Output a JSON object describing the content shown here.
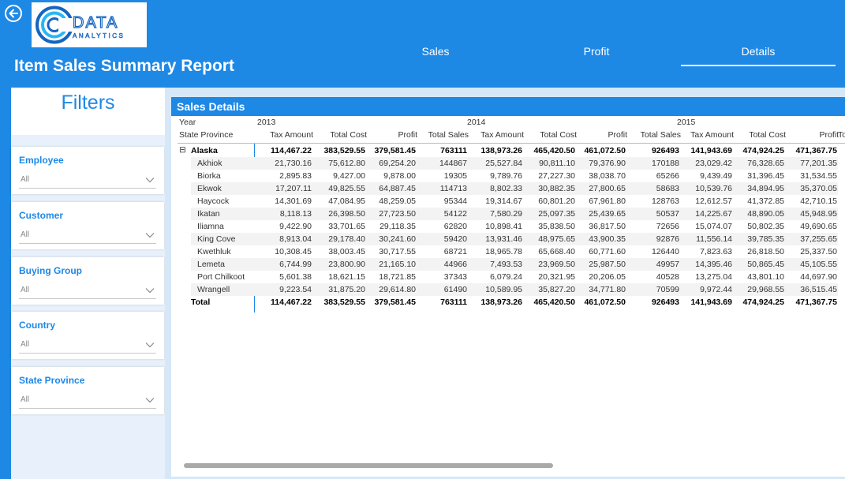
{
  "header": {
    "title": "Item Sales Summary Report",
    "logo_text": "DATA",
    "logo_subtext": "ANALYTICS",
    "tabs": [
      {
        "label": "Sales"
      },
      {
        "label": "Profit"
      },
      {
        "label": "Details"
      }
    ]
  },
  "filters": {
    "title": "Filters",
    "slicers": [
      {
        "label": "Employee",
        "value": "All"
      },
      {
        "label": "Customer",
        "value": "All"
      },
      {
        "label": "Buying Group",
        "value": "All"
      },
      {
        "label": "Country",
        "value": "All"
      },
      {
        "label": "State Province",
        "value": "All"
      }
    ]
  },
  "details": {
    "title": "Sales Details",
    "year_header": "Year",
    "row_header": "State Province",
    "years": [
      "2013",
      "2014",
      "2015"
    ],
    "measures": [
      "Tax Amount",
      "Total Cost",
      "Profit",
      "Total Sales"
    ],
    "truncated_header": "To",
    "group": {
      "expand_icon": "⊟",
      "label": "Alaska",
      "values": [
        "114,467.22",
        "383,529.55",
        "379,581.45",
        "763111",
        "138,973.26",
        "465,420.50",
        "461,072.50",
        "926493",
        "141,943.69",
        "474,924.25",
        "471,367.75"
      ]
    },
    "rows": [
      {
        "label": "Akhiok",
        "values": [
          "21,730.16",
          "75,612.80",
          "69,254.20",
          "144867",
          "25,527.84",
          "90,811.10",
          "79,376.90",
          "170188",
          "23,029.42",
          "76,328.65",
          "77,201.35"
        ]
      },
      {
        "label": "Biorka",
        "values": [
          "2,895.83",
          "9,427.00",
          "9,878.00",
          "19305",
          "9,789.76",
          "27,227.30",
          "38,038.70",
          "65266",
          "9,439.49",
          "31,396.45",
          "31,534.55"
        ]
      },
      {
        "label": "Ekwok",
        "values": [
          "17,207.11",
          "49,825.55",
          "64,887.45",
          "114713",
          "8,802.33",
          "30,882.35",
          "27,800.65",
          "58683",
          "10,539.76",
          "34,894.95",
          "35,370.05"
        ]
      },
      {
        "label": "Haycock",
        "values": [
          "14,301.69",
          "47,084.95",
          "48,259.05",
          "95344",
          "19,314.67",
          "60,801.20",
          "67,961.80",
          "128763",
          "12,612.57",
          "41,372.85",
          "42,710.15"
        ]
      },
      {
        "label": "Ikatan",
        "values": [
          "8,118.13",
          "26,398.50",
          "27,723.50",
          "54122",
          "7,580.29",
          "25,097.35",
          "25,439.65",
          "50537",
          "14,225.67",
          "48,890.05",
          "45,948.95"
        ]
      },
      {
        "label": "Iliamna",
        "values": [
          "9,422.90",
          "33,701.65",
          "29,118.35",
          "62820",
          "10,898.41",
          "35,838.50",
          "36,817.50",
          "72656",
          "15,074.07",
          "50,802.35",
          "49,690.65"
        ]
      },
      {
        "label": "King Cove",
        "values": [
          "8,913.04",
          "29,178.40",
          "30,241.60",
          "59420",
          "13,931.46",
          "48,975.65",
          "43,900.35",
          "92876",
          "11,556.14",
          "39,785.35",
          "37,255.65"
        ]
      },
      {
        "label": "Kwethluk",
        "values": [
          "10,308.45",
          "38,003.45",
          "30,717.55",
          "68721",
          "18,965.78",
          "65,668.40",
          "60,771.60",
          "126440",
          "7,823.63",
          "26,818.50",
          "25,337.50"
        ]
      },
      {
        "label": "Lemeta",
        "values": [
          "6,744.99",
          "23,800.90",
          "21,165.10",
          "44966",
          "7,493.53",
          "23,969.50",
          "25,987.50",
          "49957",
          "14,395.46",
          "50,865.45",
          "45,105.55"
        ]
      },
      {
        "label": "Port Chilkoot",
        "values": [
          "5,601.38",
          "18,621.15",
          "18,721.85",
          "37343",
          "6,079.24",
          "20,321.95",
          "20,206.05",
          "40528",
          "13,275.04",
          "43,801.10",
          "44,697.90"
        ]
      },
      {
        "label": "Wrangell",
        "values": [
          "9,223.54",
          "31,875.20",
          "29,614.80",
          "61490",
          "10,589.95",
          "35,827.20",
          "34,771.80",
          "70599",
          "9,972.44",
          "29,968.55",
          "36,515.45"
        ]
      }
    ],
    "total": {
      "label": "Total",
      "values": [
        "114,467.22",
        "383,529.55",
        "379,581.45",
        "763111",
        "138,973.26",
        "465,420.50",
        "461,072.50",
        "926493",
        "141,943.69",
        "474,924.25",
        "471,367.75"
      ]
    }
  },
  "colors": {
    "brand_blue": "#1E88E5",
    "panel_bg": "#D6E8F8",
    "filter_bg": "#E8F1FB"
  }
}
